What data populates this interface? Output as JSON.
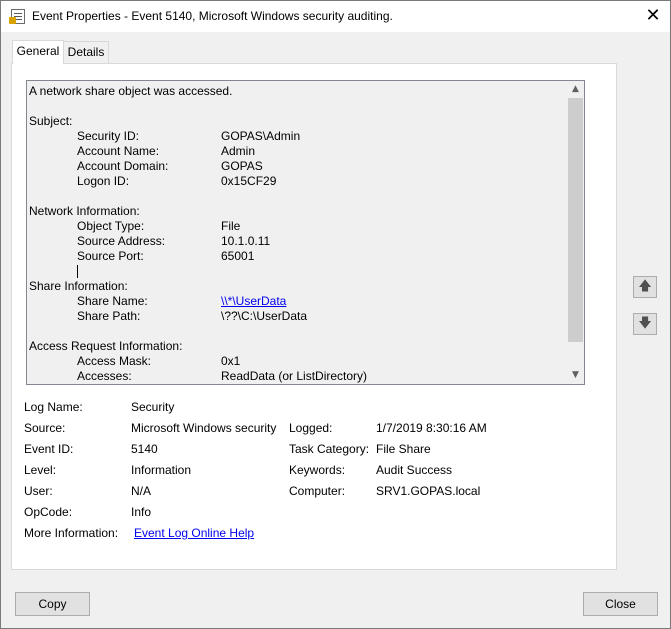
{
  "window": {
    "title": "Event Properties - Event 5140, Microsoft Windows security auditing.",
    "close_glyph": "✕"
  },
  "tabs": [
    {
      "label": "General",
      "selected": true
    },
    {
      "label": "Details",
      "selected": false
    }
  ],
  "description": {
    "headline": "A network share object was accessed.",
    "subject": {
      "heading": "Subject:",
      "fields": [
        {
          "label": "Security ID:",
          "value": "GOPAS\\Admin"
        },
        {
          "label": "Account Name:",
          "value": "Admin"
        },
        {
          "label": "Account Domain:",
          "value": "GOPAS"
        },
        {
          "label": "Logon ID:",
          "value": "0x15CF29"
        }
      ]
    },
    "network": {
      "heading": "Network Information:",
      "fields": [
        {
          "label": "Object Type:",
          "value": "File"
        },
        {
          "label": "Source Address:",
          "value": "10.1.0.11"
        },
        {
          "label": "Source Port:",
          "value": "65001"
        }
      ]
    },
    "share": {
      "heading": "Share Information:",
      "fields": [
        {
          "label": "Share Name:",
          "value": "\\\\*\\UserData"
        },
        {
          "label": "Share Path:",
          "value": "\\??\\C:\\UserData"
        }
      ]
    },
    "access": {
      "heading": "Access Request Information:",
      "fields": [
        {
          "label": "Access Mask:",
          "value": "0x1"
        },
        {
          "label": "Accesses:",
          "value": "ReadData (or ListDirectory)"
        }
      ]
    }
  },
  "scrollbar": {
    "up_glyph": "▲",
    "down_glyph": "▼"
  },
  "properties": {
    "log_name": {
      "label": "Log Name:",
      "value": "Security"
    },
    "source": {
      "label": "Source:",
      "value": "Microsoft Windows security"
    },
    "logged": {
      "label": "Logged:",
      "value": "1/7/2019 8:30:16 AM"
    },
    "event_id": {
      "label": "Event ID:",
      "value": "5140"
    },
    "task_category": {
      "label": "Task Category:",
      "value": "File Share"
    },
    "level": {
      "label": "Level:",
      "value": "Information"
    },
    "keywords": {
      "label": "Keywords:",
      "value": "Audit Success"
    },
    "user": {
      "label": "User:",
      "value": "N/A"
    },
    "computer": {
      "label": "Computer:",
      "value": "SRV1.GOPAS.local"
    },
    "opcode": {
      "label": "OpCode:",
      "value": "Info"
    },
    "more_info": {
      "label": "More Information:",
      "link": "Event Log Online Help"
    }
  },
  "nav": {
    "up_icon": "🡅",
    "down_icon": "🡇"
  },
  "buttons": {
    "copy": "Copy",
    "close": "Close"
  }
}
